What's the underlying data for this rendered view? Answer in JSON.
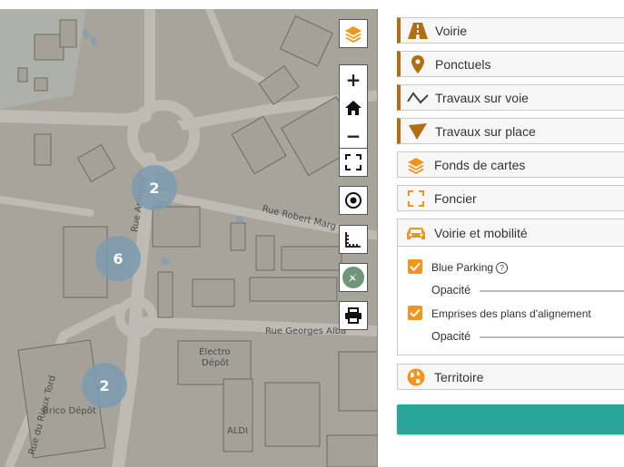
{
  "map": {
    "street_labels": [
      "Rue Armand",
      "Rue Robert Marg",
      "Rue Georges Alba",
      "Rue du Rieux Tord"
    ],
    "place_labels": [
      "Électro",
      "Dépôt",
      "Brico Dépôt",
      "ALDI"
    ],
    "clusters": [
      {
        "count": "2"
      },
      {
        "count": "6"
      },
      {
        "count": "2"
      }
    ],
    "controls": {
      "layers_icon": "layers-icon",
      "zoom_in": "+",
      "home_icon": "home-icon",
      "zoom_out": "−",
      "fullscreen_icon": "fullscreen-icon",
      "locate_icon": "locate-icon",
      "measure_icon": "ruler-icon",
      "compass_icon": "compass-icon",
      "print_icon": "print-icon"
    },
    "colors": {
      "accent": "#f0961e",
      "cluster": "#7d9bb0",
      "map_bg": "#a6a49b"
    }
  },
  "panel": {
    "layers": [
      {
        "label": "Voirie",
        "icon": "road-icon",
        "accent": true
      },
      {
        "label": "Ponctuels",
        "icon": "map-pin-icon",
        "accent": true
      },
      {
        "label": "Travaux sur voie",
        "icon": "line-icon",
        "accent": true
      },
      {
        "label": "Travaux sur place",
        "icon": "triangle-icon",
        "accent": true
      },
      {
        "label": "Fonds de cartes",
        "icon": "layers-icon",
        "accent": false
      },
      {
        "label": "Foncier",
        "icon": "frame-icon",
        "accent": false
      },
      {
        "label": "Voirie et mobilité",
        "icon": "car-icon",
        "accent": false
      },
      {
        "label": "Territoire",
        "icon": "globe-icon",
        "accent": false
      }
    ],
    "mobility": {
      "items": [
        {
          "label": "Blue Parking",
          "checked": true,
          "help": "?",
          "opacity_label": "Opacité"
        },
        {
          "label": "Emprises des plans d'alignement",
          "checked": true,
          "opacity_label": "Opacité"
        }
      ]
    },
    "colors": {
      "accent_bar": "#b26e12",
      "icon": "#f0961e",
      "button": "#2aa59a"
    }
  }
}
